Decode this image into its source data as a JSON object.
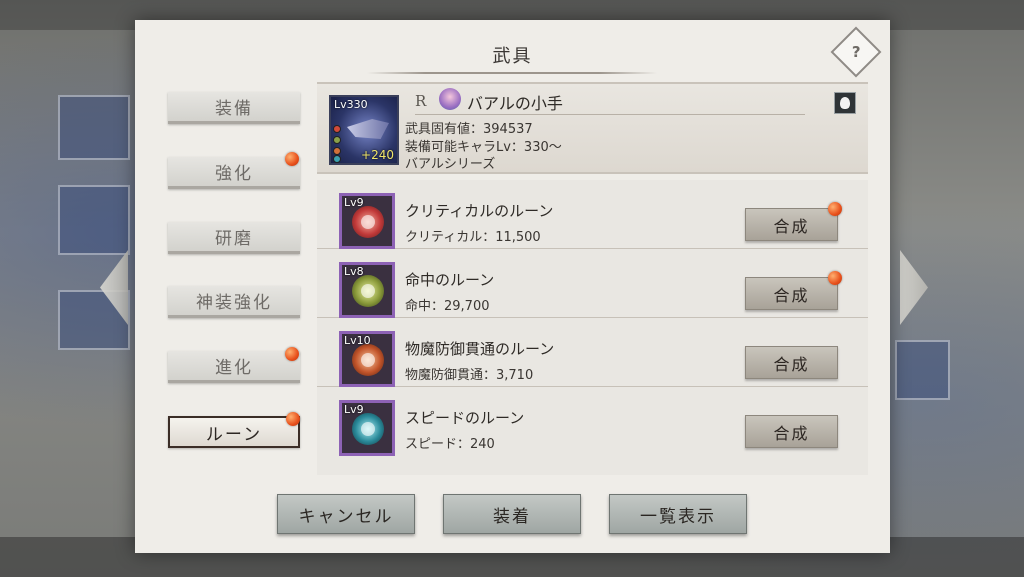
{
  "dialog": {
    "title": "武具",
    "help_label": "?"
  },
  "tabs": [
    {
      "label": "装備",
      "badge": false,
      "active": false
    },
    {
      "label": "強化",
      "badge": true,
      "active": false
    },
    {
      "label": "研磨",
      "badge": false,
      "active": false
    },
    {
      "label": "神装強化",
      "badge": false,
      "active": false
    },
    {
      "label": "進化",
      "badge": true,
      "active": false
    },
    {
      "label": "ルーン",
      "badge": true,
      "active": true
    }
  ],
  "weapon": {
    "level": "Lv330",
    "plus": "+240",
    "rarity": "R",
    "name": "バアルの小手",
    "value_line": "武具固有値：394537",
    "equip_line": "装備可能キャラLv：330～",
    "series_line": "バアルシリーズ"
  },
  "runes": [
    {
      "level": "Lv9",
      "name": "クリティカルのルーン",
      "stat": "クリティカル：11,500",
      "button": "合成",
      "badge": true,
      "color": "#c23a3a"
    },
    {
      "level": "Lv8",
      "name": "命中のルーン",
      "stat": "命中：29,700",
      "button": "合成",
      "badge": true,
      "color": "#8a9a3a"
    },
    {
      "level": "Lv10",
      "name": "物魔防御貫通のルーン",
      "stat": "物魔防御貫通：3,710",
      "button": "合成",
      "badge": false,
      "color": "#c2542a"
    },
    {
      "level": "Lv9",
      "name": "スピードのルーン",
      "stat": "スピード：240",
      "button": "合成",
      "badge": false,
      "color": "#2a8a9a"
    }
  ],
  "footer": {
    "cancel_label": "キャンセル",
    "equip_label": "装着",
    "list_label": "一覧表示"
  }
}
